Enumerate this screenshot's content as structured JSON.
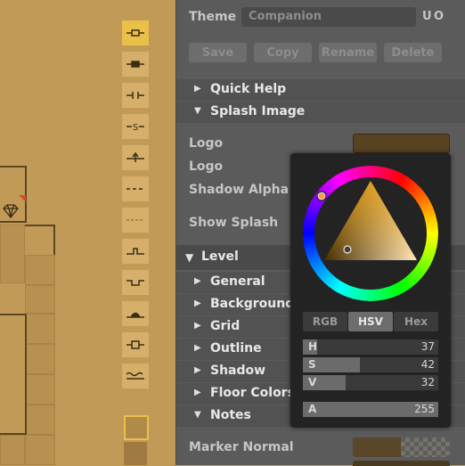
{
  "toolbar": {
    "tools": [
      {
        "icon": "connector-open-icon",
        "active": true
      },
      {
        "icon": "connector-filled-icon",
        "active": false
      },
      {
        "icon": "connector-gap-icon",
        "active": false
      },
      {
        "icon": "connector-s-icon",
        "active": false
      },
      {
        "icon": "connector-arrow-icon",
        "active": false
      },
      {
        "icon": "dashed-line-icon",
        "active": false
      },
      {
        "icon": "dotted-line-icon",
        "active": false
      },
      {
        "icon": "step-up-icon",
        "active": false
      },
      {
        "icon": "step-down-icon",
        "active": false
      },
      {
        "icon": "arch-icon",
        "active": false
      },
      {
        "icon": "box-connector-icon",
        "active": false
      },
      {
        "icon": "wavy-line-icon",
        "active": false
      }
    ]
  },
  "theme": {
    "label": "Theme",
    "value": "Companion",
    "u": "U",
    "o": "O"
  },
  "actions": {
    "save": "Save",
    "copy": "Copy",
    "rename": "Rename",
    "delete": "Delete"
  },
  "sections": {
    "quick_help": "Quick Help",
    "splash_image": "Splash Image",
    "level": "Level",
    "general": "General",
    "background": "Background Ha",
    "grid": "Grid",
    "outline": "Outline",
    "shadow": "Shadow",
    "floor_colors": "Floor Colors",
    "notes": "Notes"
  },
  "splash": {
    "logo1": "Logo",
    "logo2": "Logo",
    "shadow_alpha": "Shadow Alpha",
    "show_splash": "Show Splash"
  },
  "notes": {
    "marker_normal": "Marker Normal"
  },
  "color_picker": {
    "tabs": {
      "rgb": "RGB",
      "hsv": "HSV",
      "hex": "Hex"
    },
    "h": {
      "label": "H",
      "value": "37"
    },
    "s": {
      "label": "S",
      "value": "42"
    },
    "v": {
      "label": "V",
      "value": "32"
    },
    "a": {
      "label": "A",
      "value": "255"
    },
    "levels": {
      "h": 0.103,
      "s": 0.42,
      "v": 0.32,
      "a": 1.0
    },
    "colors": {
      "swatch": "#574221",
      "hue": "#ffa800"
    }
  },
  "colors": {
    "canvas": "#c29a58",
    "panel": "#5b5b5b",
    "active_tool": "#eac047"
  }
}
